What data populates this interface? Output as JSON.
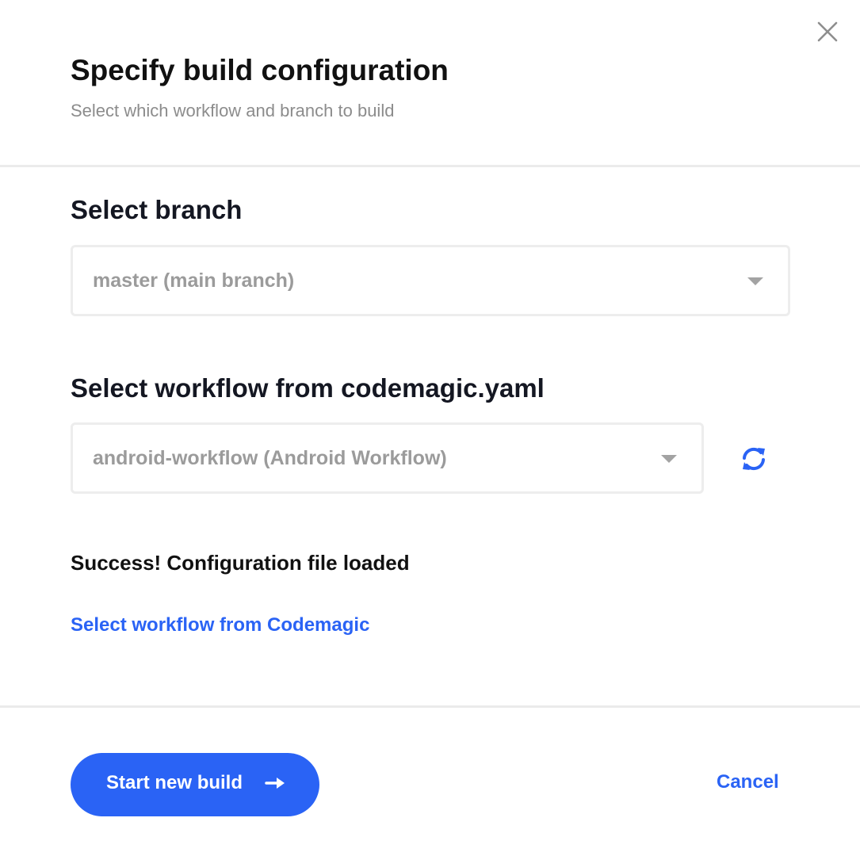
{
  "dialog": {
    "title": "Specify build configuration",
    "subtitle": "Select which workflow and branch to build",
    "close_icon": "close-icon"
  },
  "branch": {
    "label": "Select branch",
    "selected": "master (main branch)"
  },
  "workflow": {
    "label": "Select workflow from codemagic.yaml",
    "selected": "android-workflow (Android Workflow)",
    "refresh_icon": "refresh-icon"
  },
  "status": {
    "message": "Success! Configuration file loaded"
  },
  "links": {
    "alt_workflow": "Select workflow from Codemagic"
  },
  "footer": {
    "start_label": "Start new build",
    "start_icon": "arrow-right-icon",
    "cancel_label": "Cancel"
  },
  "colors": {
    "accent": "#2a63f5",
    "title": "#111111",
    "muted": "#8c8c8c",
    "divider": "#ebebeb"
  }
}
